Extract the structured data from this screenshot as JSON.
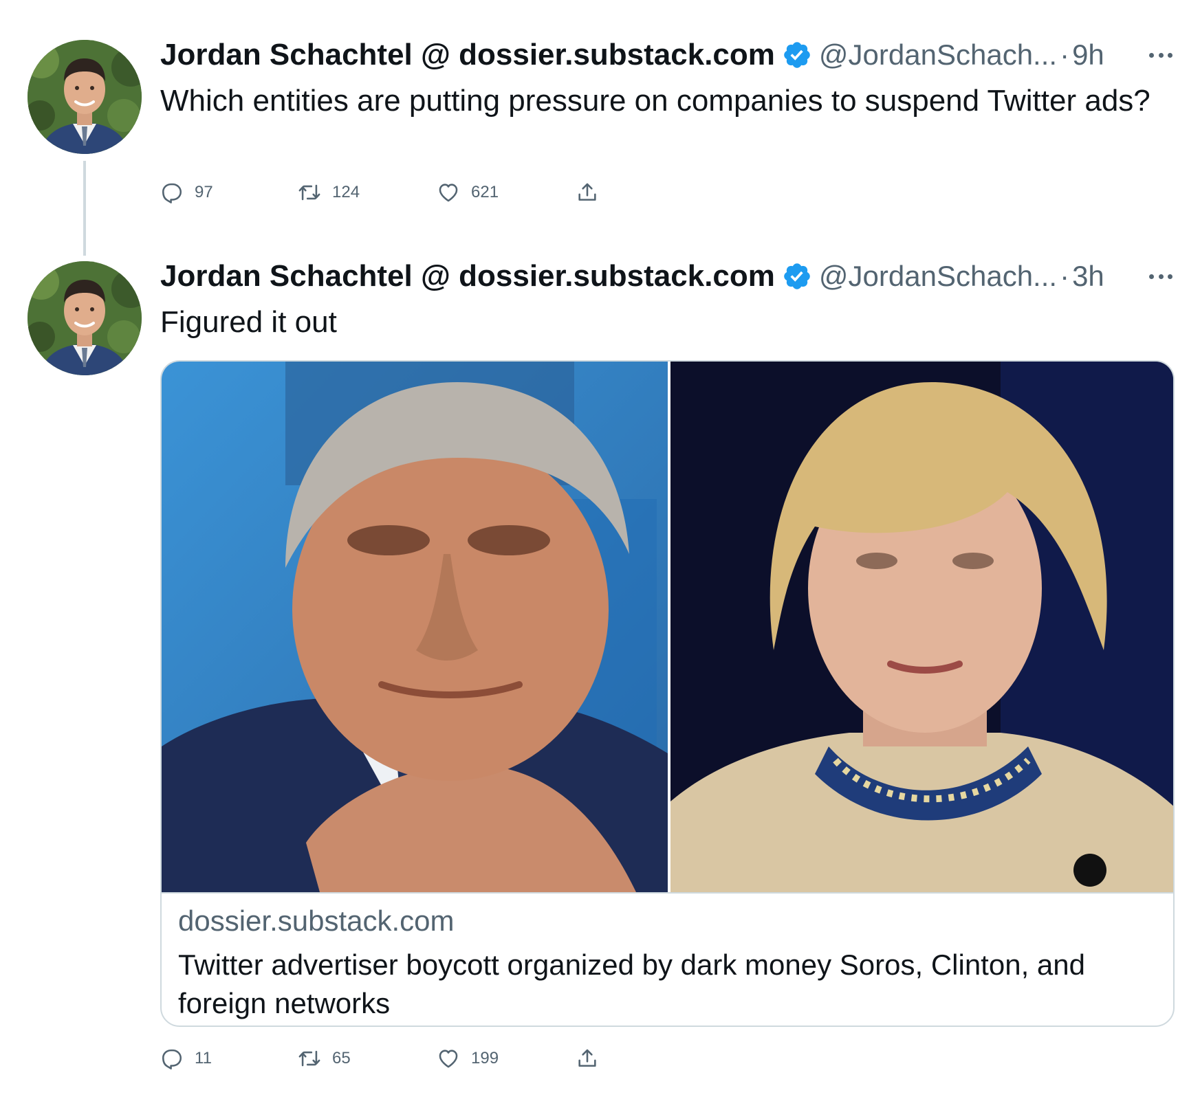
{
  "tweet1": {
    "author_name": "Jordan Schachtel @ dossier.substack.com",
    "handle": "@JordanSchach...",
    "separator": "·",
    "time": "9h",
    "text": "Which entities are putting pressure on companies to suspend Twitter ads?",
    "replies": "97",
    "retweets": "124",
    "likes": "621"
  },
  "tweet2": {
    "author_name": "Jordan Schachtel @ dossier.substack.com",
    "handle": "@JordanSchach...",
    "separator": "·",
    "time": "3h",
    "text": "Figured it out",
    "card": {
      "domain": "dossier.substack.com",
      "title": "Twitter advertiser boycott organized by dark money Soros, Clinton, and foreign networks"
    },
    "replies": "11",
    "retweets": "65",
    "likes": "199"
  },
  "icons": {
    "verified": "verified-badge-icon",
    "reply": "reply-icon",
    "retweet": "retweet-icon",
    "like": "heart-icon",
    "share": "share-icon",
    "more": "more-icon"
  },
  "colors": {
    "verified": "#1d9bf0",
    "secondary_text": "#536471",
    "border": "#cfd9de"
  }
}
